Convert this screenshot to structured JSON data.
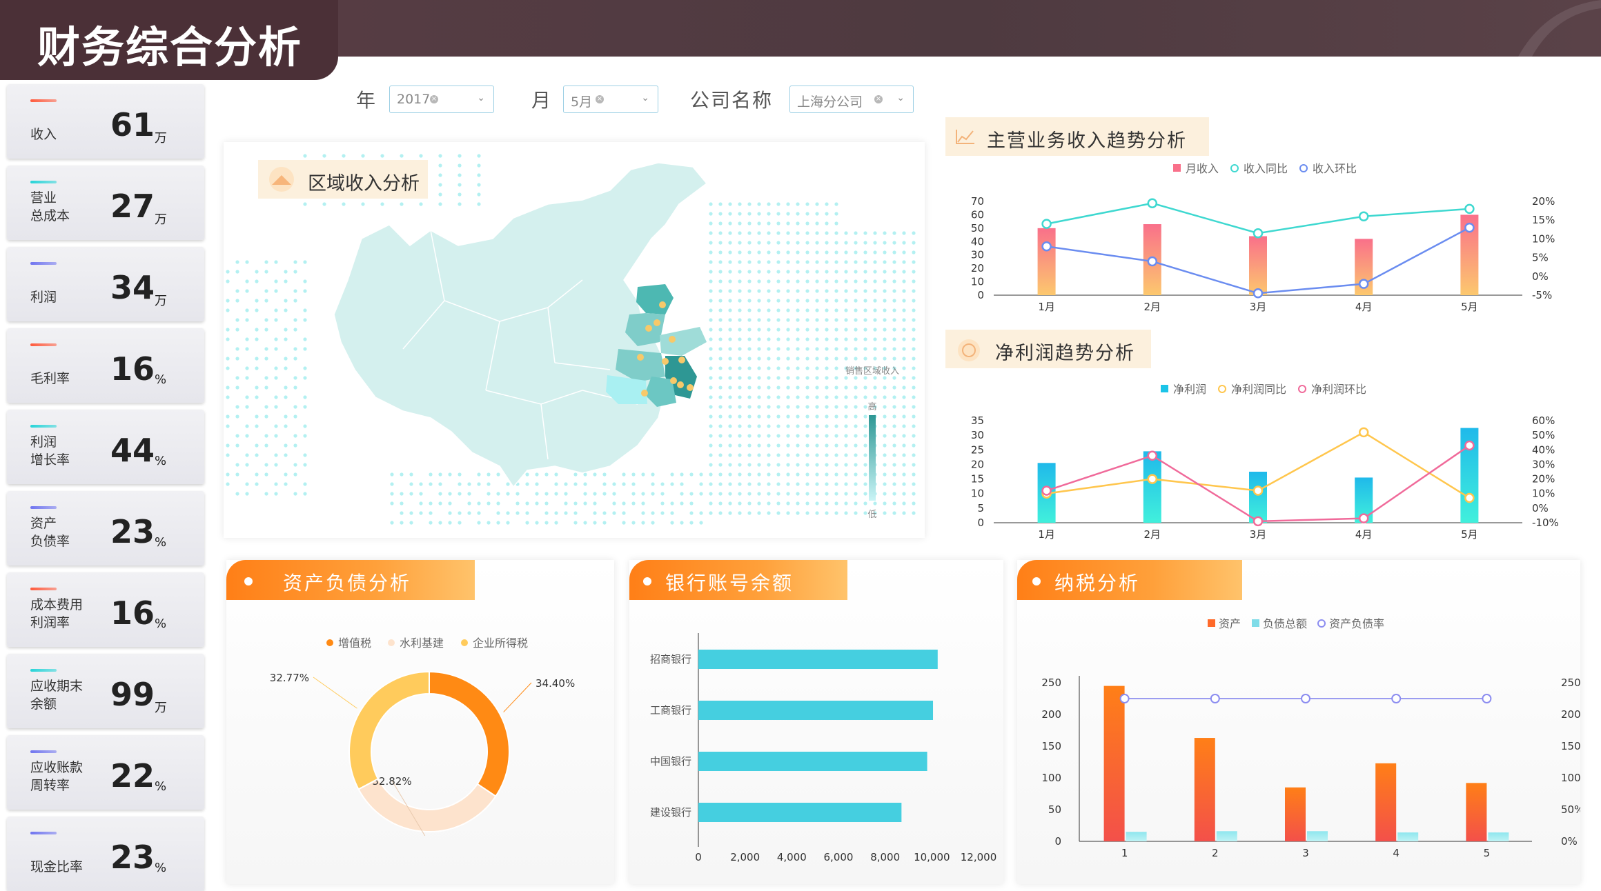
{
  "header": {
    "title": "财务综合分析"
  },
  "kpis": [
    {
      "label": "收入",
      "value": "61",
      "unit": "万",
      "color": "#ff5a3c"
    },
    {
      "label": "营业\n总成本",
      "value": "27",
      "unit": "万",
      "color": "#26d4d8"
    },
    {
      "label": "利润",
      "value": "34",
      "unit": "万",
      "color": "#6f74f0"
    },
    {
      "label": "毛利率",
      "value": "16",
      "unit": "%",
      "color": "#ff5a3c"
    },
    {
      "label": "利润\n增长率",
      "value": "44",
      "unit": "%",
      "color": "#26d4d8"
    },
    {
      "label": "资产\n负债率",
      "value": "23",
      "unit": "%",
      "color": "#6f74f0"
    },
    {
      "label": "成本费用\n利润率",
      "value": "16",
      "unit": "%",
      "color": "#ff5a3c"
    },
    {
      "label": "应收期末\n余额",
      "value": "99",
      "unit": "万",
      "color": "#26d4d8"
    },
    {
      "label": "应收账款\n周转率",
      "value": "22",
      "unit": "%",
      "color": "#6f74f0"
    },
    {
      "label": "现金比率",
      "value": "23",
      "unit": "%",
      "color": "#6f74f0"
    }
  ],
  "filters": {
    "year_label": "年",
    "year_value": "2017",
    "month_label": "月",
    "month_value": "5月",
    "company_label": "公司名称",
    "company_value": "上海分公司"
  },
  "map_panel": {
    "title": "区域收入分析",
    "legend_title": "销售区域收入",
    "legend_high": "高",
    "legend_low": "低"
  },
  "revenue_trend": {
    "title": "主营业务收入趋势分析",
    "chart_data": {
      "type": "bar",
      "categories": [
        "1月",
        "2月",
        "3月",
        "4月",
        "5月"
      ],
      "series": [
        {
          "name": "月收入",
          "values": [
            50,
            53,
            44,
            42,
            60
          ],
          "axis": "left"
        },
        {
          "name": "收入同比",
          "values": [
            14,
            19.5,
            11.5,
            16,
            18
          ],
          "axis": "right"
        },
        {
          "name": "收入环比",
          "values": [
            8,
            4,
            -4.5,
            -2,
            13
          ],
          "axis": "right"
        }
      ],
      "left_ticks": [
        "0",
        "10",
        "20",
        "30",
        "40",
        "50",
        "60",
        "70"
      ],
      "right_ticks": [
        "-5%",
        "0%",
        "5%",
        "10%",
        "15%",
        "20%"
      ],
      "ylim_left": [
        0,
        70
      ],
      "ylim_right": [
        -5,
        20
      ]
    }
  },
  "profit_trend": {
    "title": "净利润趋势分析",
    "chart_data": {
      "type": "bar",
      "categories": [
        "1月",
        "2月",
        "3月",
        "4月",
        "5月"
      ],
      "series": [
        {
          "name": "净利润",
          "values": [
            20.5,
            24.5,
            17.5,
            15.5,
            32.5
          ],
          "axis": "left"
        },
        {
          "name": "净利润同比",
          "values": [
            10,
            20,
            12,
            52,
            7
          ],
          "axis": "right"
        },
        {
          "name": "净利润环比",
          "values": [
            12,
            36,
            -9,
            -7,
            43
          ],
          "axis": "right"
        }
      ],
      "left_ticks": [
        "0",
        "5",
        "10",
        "15",
        "20",
        "25",
        "30",
        "35"
      ],
      "right_ticks": [
        "-10%",
        "0%",
        "10%",
        "20%",
        "30%",
        "40%",
        "50%",
        "60%"
      ],
      "ylim_left": [
        0,
        35
      ],
      "ylim_right": [
        -10,
        60
      ]
    }
  },
  "asset_panel": {
    "title": "资产负债分析",
    "chart_data": {
      "type": "pie",
      "labels": [
        "增值税",
        "水利基建",
        "企业所得税"
      ],
      "values": [
        34.4,
        32.82,
        32.77
      ],
      "value_labels": [
        "34.40%",
        "32.82%",
        "32.77%"
      ],
      "colors": [
        "#ff8a14",
        "#fde3cd",
        "#ffcb5c"
      ]
    }
  },
  "bank_panel": {
    "title": "银行账号余额",
    "chart_data": {
      "type": "bar",
      "orientation": "horizontal",
      "categories": [
        "招商银行",
        "工商银行",
        "中国银行",
        "建设银行"
      ],
      "values": [
        10250,
        10050,
        9800,
        8700
      ],
      "x_ticks": [
        "0",
        "2,000",
        "4,000",
        "6,000",
        "8,000",
        "10,000",
        "12,000"
      ],
      "xlim": [
        0,
        12000
      ]
    }
  },
  "tax_panel": {
    "title": "纳税分析",
    "chart_data": {
      "type": "bar",
      "categories": [
        "1",
        "2",
        "3",
        "4",
        "5"
      ],
      "series": [
        {
          "name": "资产",
          "values": [
            245,
            163,
            85,
            123,
            92
          ],
          "axis": "left"
        },
        {
          "name": "负债总额",
          "values": [
            15,
            16,
            16,
            14,
            14
          ],
          "axis": "left"
        },
        {
          "name": "资产负债率",
          "values": [
            225,
            225,
            225,
            225,
            225
          ],
          "axis": "right"
        }
      ],
      "left_ticks": [
        "0",
        "50",
        "100",
        "150",
        "200",
        "250"
      ],
      "right_ticks": [
        "0%",
        "50%",
        "100%",
        "150%",
        "200%",
        "250%"
      ],
      "ylim_left": [
        0,
        250
      ],
      "ylim_right": [
        0,
        250
      ]
    }
  }
}
